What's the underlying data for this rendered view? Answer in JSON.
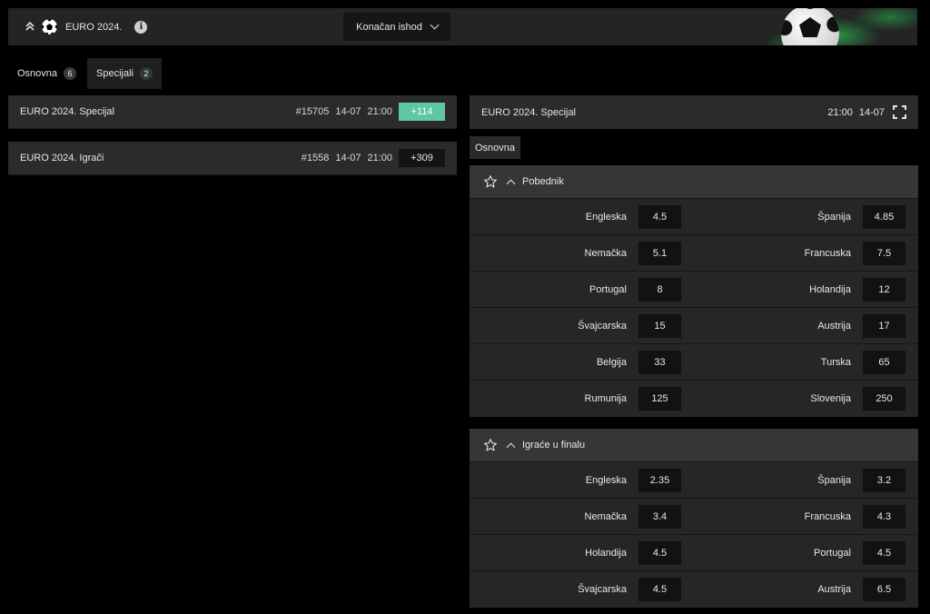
{
  "header": {
    "title": "EURO 2024.",
    "market_select": "Konačan ishod"
  },
  "tabs": [
    {
      "label": "Osnovna",
      "count": "6"
    },
    {
      "label": "Specijali",
      "count": "2"
    }
  ],
  "events": [
    {
      "name": "EURO 2024. Specijal",
      "code": "#15705",
      "date": "14-07",
      "time": "21:00",
      "more": "+114"
    },
    {
      "name": "EURO 2024. Igrači",
      "code": "#1558",
      "date": "14-07",
      "time": "21:00",
      "more": "+309"
    }
  ],
  "detail": {
    "name": "EURO 2024. Specijal",
    "time": "21:00",
    "date": "14-07",
    "subtab": "Osnovna"
  },
  "markets": [
    {
      "name": "Pobednik",
      "rows": [
        [
          {
            "label": "Engleska",
            "odd": "4.5"
          },
          {
            "label": "Španija",
            "odd": "4.85"
          }
        ],
        [
          {
            "label": "Nemačka",
            "odd": "5.1"
          },
          {
            "label": "Francuska",
            "odd": "7.5"
          }
        ],
        [
          {
            "label": "Portugal",
            "odd": "8"
          },
          {
            "label": "Holandija",
            "odd": "12"
          }
        ],
        [
          {
            "label": "Švajcarska",
            "odd": "15"
          },
          {
            "label": "Austrija",
            "odd": "17"
          }
        ],
        [
          {
            "label": "Belgija",
            "odd": "33"
          },
          {
            "label": "Turska",
            "odd": "65"
          }
        ],
        [
          {
            "label": "Rumunija",
            "odd": "125"
          },
          {
            "label": "Slovenija",
            "odd": "250"
          }
        ]
      ]
    },
    {
      "name": "Igraće u finalu",
      "rows": [
        [
          {
            "label": "Engleska",
            "odd": "2.35"
          },
          {
            "label": "Španija",
            "odd": "3.2"
          }
        ],
        [
          {
            "label": "Nemačka",
            "odd": "3.4"
          },
          {
            "label": "Francuska",
            "odd": "4.3"
          }
        ],
        [
          {
            "label": "Holandija",
            "odd": "4.5"
          },
          {
            "label": "Portugal",
            "odd": "4.5"
          }
        ],
        [
          {
            "label": "Švajcarska",
            "odd": "4.5"
          },
          {
            "label": "Austrija",
            "odd": "6.5"
          }
        ]
      ]
    }
  ],
  "colors": {
    "accent": "#5ec8a2",
    "background": "#000000",
    "panel": "#2b2b2b"
  },
  "icons": [
    "chevrons-up-icon",
    "soccer-ball-icon",
    "info-icon",
    "chevron-down-icon",
    "expand-icon",
    "star-icon",
    "caret-up-icon"
  ]
}
